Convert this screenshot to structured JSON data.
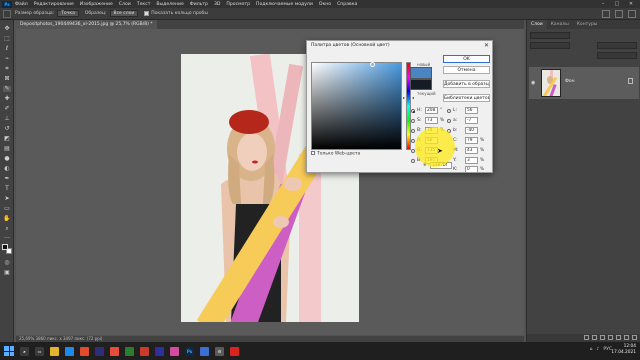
{
  "menubar": {
    "logo": "Ps",
    "items": [
      "Файл",
      "Редактирование",
      "Изображение",
      "Слои",
      "Текст",
      "Выделение",
      "Фильтр",
      "3D",
      "Просмотр",
      "Подключаемые модули",
      "Окно",
      "Справка"
    ],
    "window_controls": [
      "–",
      "□",
      "✕"
    ]
  },
  "options_bar": {
    "sample_size_label": "Размер образца:",
    "sample_size_value": "Точка",
    "sample_label": "Образец:",
    "sample_value": "Все слои",
    "show_ring_label": "Показать кольцо пробы"
  },
  "document_tab": {
    "label": "Depositphotos_190449436_xl-2015.jpg @ 25,7% (RGB/8) *"
  },
  "status_bar": {
    "text": "25,69%   3860 пикс. x 3497 пикс. (72 ppi)"
  },
  "right_panel": {
    "tabs": [
      "Слои",
      "Каналы",
      "Контуры"
    ],
    "layer_name": "Фон"
  },
  "color_picker": {
    "title": "Палитра цветов (Основной цвет)",
    "close": "✕",
    "new_label": "новый",
    "current_label": "текущий",
    "new_color": "#4a84c1",
    "current_color": "#151c25",
    "buttons": {
      "ok": "OK",
      "cancel": "Отмена",
      "add_to_swatches": "Добавить в образцы",
      "color_libraries": "Библиотеки цветов"
    },
    "web_only": "Только Web-цвета",
    "hsb": {
      "h_label": "H:",
      "h_value": "208",
      "h_unit": "°",
      "s_label": "S:",
      "s_value": "73",
      "s_unit": "%",
      "b_label": "B:",
      "b_value": "74",
      "b_unit": "%"
    },
    "rgb": {
      "r_label": "R:",
      "r_value": "50",
      "g_label": "G:",
      "g_value": "135",
      "b_label": "B:",
      "b_value": "191"
    },
    "lab": {
      "l_label": "L:",
      "l_value": "56",
      "a_label": "a:",
      "a_value": "-7",
      "b_label": "b:",
      "b_value": "-40"
    },
    "cmyk": {
      "c_label": "C:",
      "c_value": "79",
      "c_unit": "%",
      "m_label": "M:",
      "m_value": "43",
      "m_unit": "%",
      "y_label": "Y:",
      "y_value": "3",
      "y_unit": "%",
      "k_label": "K:",
      "k_value": "0",
      "k_unit": "%"
    },
    "hex_label": "#",
    "hex_value": "3387bf"
  },
  "taskbar": {
    "time": "12:04",
    "date": "17.04.2021",
    "lang": "РУС"
  }
}
